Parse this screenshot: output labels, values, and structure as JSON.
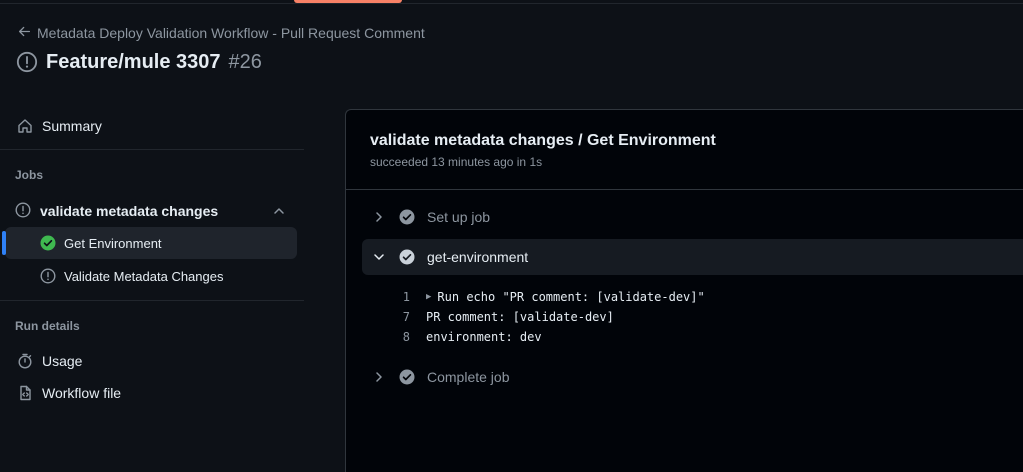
{
  "header": {
    "back_label": "Metadata Deploy Validation Workflow - Pull Request Comment",
    "run_name": "Feature/mule 3307",
    "run_number": "#26"
  },
  "sidebar": {
    "summary_label": "Summary",
    "jobs_heading": "Jobs",
    "job_group_label": "validate metadata changes",
    "jobs": [
      {
        "label": "Get Environment",
        "status": "success"
      },
      {
        "label": "Validate Metadata Changes",
        "status": "neutral"
      }
    ],
    "run_details_heading": "Run details",
    "usage_label": "Usage",
    "workflow_file_label": "Workflow file"
  },
  "main": {
    "title": "validate metadata changes / Get Environment",
    "subtitle": "succeeded 13 minutes ago in 1s",
    "steps": [
      {
        "label": "Set up job",
        "expanded": false
      },
      {
        "label": "get-environment",
        "expanded": true
      },
      {
        "label": "Complete job",
        "expanded": false
      }
    ],
    "log": [
      {
        "num": "1",
        "text": "Run echo \"PR comment: [validate-dev]\"",
        "collapsible": true
      },
      {
        "num": "7",
        "text": "PR comment: [validate-dev]",
        "collapsible": false
      },
      {
        "num": "8",
        "text": "environment: dev",
        "collapsible": false
      }
    ]
  },
  "colors": {
    "background": "#0d1117",
    "panel": "#010409",
    "accent_blue": "#2f81f7",
    "success_green": "#3fb950",
    "muted_text": "#8d96a0",
    "tab_underline": "#f78166"
  }
}
